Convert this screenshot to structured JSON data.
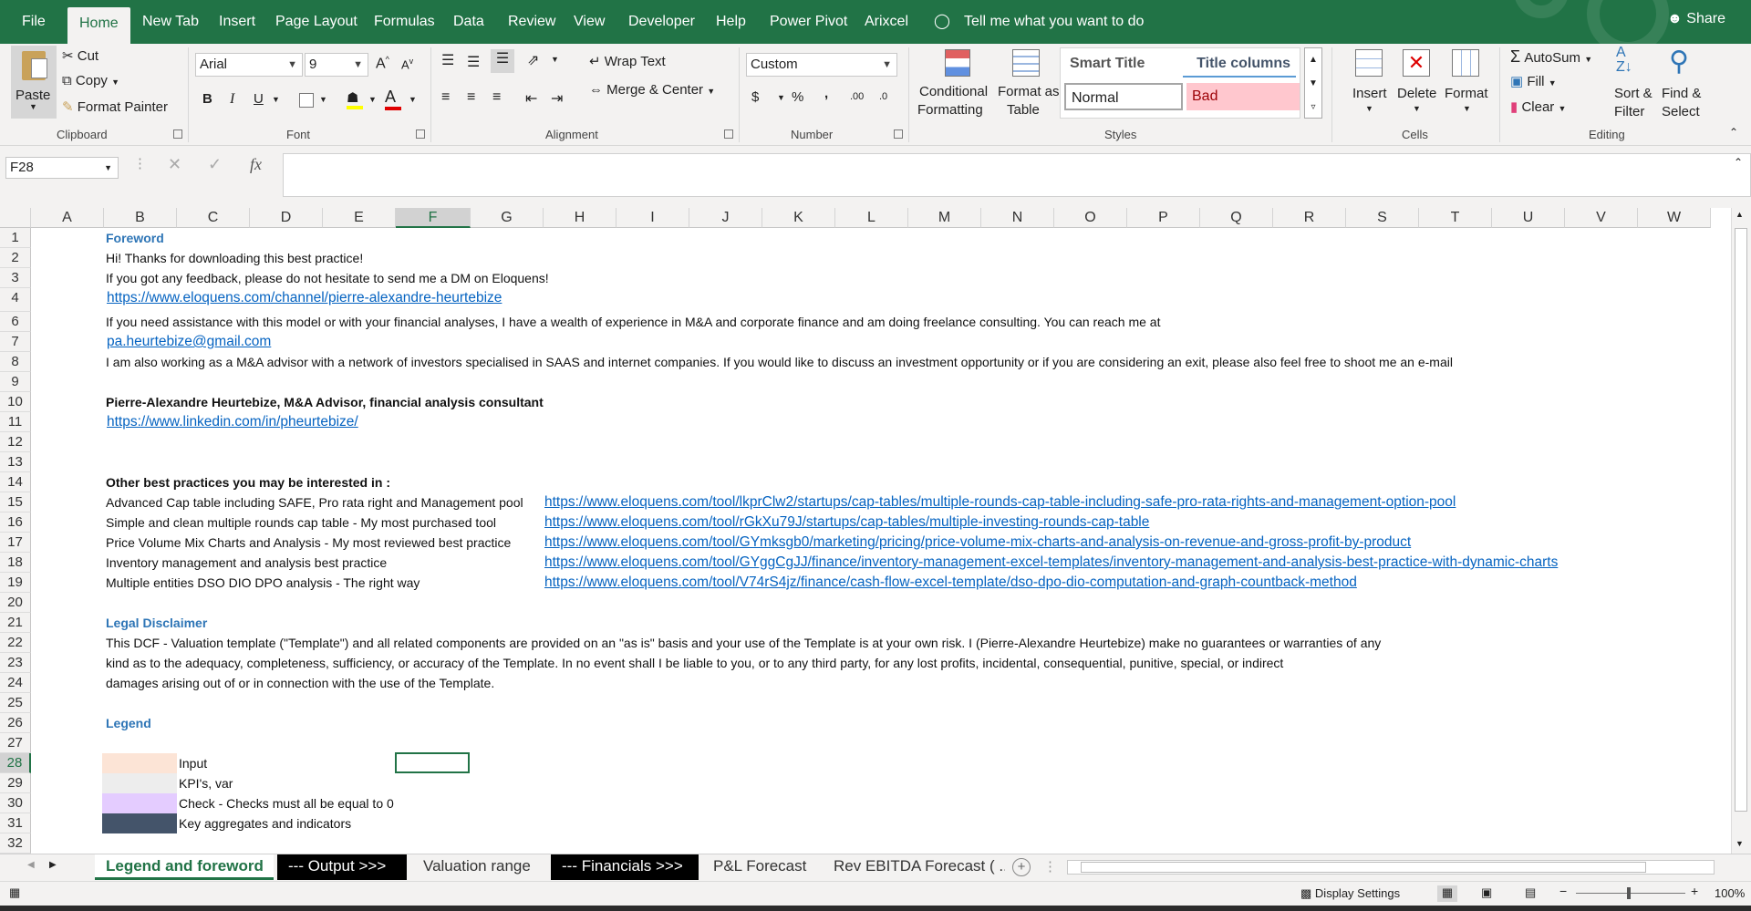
{
  "menu": {
    "tabs": [
      "File",
      "Home",
      "New Tab",
      "Insert",
      "Page Layout",
      "Formulas",
      "Data",
      "Review",
      "View",
      "Developer",
      "Help",
      "Power Pivot",
      "Arixcel"
    ],
    "tell_me": "Tell me what you want to do",
    "share": "Share"
  },
  "ribbon": {
    "clipboard": {
      "paste": "Paste",
      "cut": "Cut",
      "copy": "Copy",
      "format_painter": "Format Painter",
      "label": "Clipboard"
    },
    "font": {
      "name": "Arial",
      "size": "9",
      "bold": "B",
      "italic": "I",
      "underline": "U",
      "label": "Font"
    },
    "alignment": {
      "wrap": "Wrap Text",
      "merge": "Merge & Center",
      "label": "Alignment"
    },
    "number": {
      "format": "Custom",
      "percent": "%",
      "comma": ",",
      "inc_decimal": ".00",
      "dec_decimal": ".0",
      "label": "Number"
    },
    "styles": {
      "conditional_1": "Conditional",
      "conditional_2": "Formatting",
      "format_table_1": "Format as",
      "format_table_2": "Table",
      "smart_title": "Smart Title",
      "title_columns": "Title columns",
      "normal": "Normal",
      "bad": "Bad",
      "label": "Styles"
    },
    "cells": {
      "insert": "Insert",
      "delete": "Delete",
      "format": "Format",
      "label": "Cells"
    },
    "editing": {
      "autosum": "AutoSum",
      "fill": "Fill",
      "clear": "Clear",
      "sort_1": "Sort &",
      "sort_2": "Filter",
      "find_1": "Find &",
      "find_2": "Select",
      "label": "Editing"
    }
  },
  "formula_bar": {
    "name_box": "F28",
    "fx": "fx",
    "content": ""
  },
  "columns": [
    "A",
    "B",
    "C",
    "D",
    "E",
    "F",
    "G",
    "H",
    "I",
    "J",
    "K",
    "L",
    "M",
    "N",
    "O",
    "P",
    "Q",
    "R",
    "S",
    "T",
    "U",
    "V",
    "W"
  ],
  "selected_column": "F",
  "rows": [
    "1",
    "2",
    "3",
    "4",
    "6",
    "7",
    "8",
    "9",
    "10",
    "11",
    "12",
    "13",
    "14",
    "15",
    "16",
    "17",
    "18",
    "19",
    "20",
    "21",
    "22",
    "23",
    "24",
    "25",
    "26",
    "27",
    "28",
    "29",
    "30",
    "31",
    "32"
  ],
  "selected_row": "28",
  "content": {
    "foreword_title": "Foreword",
    "hi": "Hi! Thanks for downloading this best practice!",
    "feedback": "If you got any feedback, please do not hesitate to send me a DM on Eloquens!",
    "eloquens_link": "https://www.eloquens.com/channel/pierre-alexandre-heurtebize",
    "assistance": "If you need assistance with this model or with your financial analyses, I have a wealth of experience in M&A and corporate finance and am doing freelance consulting. You can reach me at",
    "email": "pa.heurtebize@gmail.com",
    "advisor_text": "I am also working as a M&A advisor with a network of investors specialised in SAAS and internet companies. If you would like to discuss an investment opportunity or if you are considering an exit, please also feel free to shoot me an e-mail",
    "signature": "Pierre-Alexandre Heurtebize, M&A Advisor, financial analysis consultant",
    "linkedin": "https://www.linkedin.com/in/pheurtebize/",
    "other_title": "Other best practices you may be interested in :",
    "practices": [
      {
        "name": "Advanced Cap table including SAFE, Pro rata right and Management pool",
        "url": "https://www.eloquens.com/tool/lkprClw2/startups/cap-tables/multiple-rounds-cap-table-including-safe-pro-rata-rights-and-management-option-pool"
      },
      {
        "name": "Simple and clean multiple rounds cap table - My most purchased tool",
        "url": "https://www.eloquens.com/tool/rGkXu79J/startups/cap-tables/multiple-investing-rounds-cap-table"
      },
      {
        "name": "Price Volume Mix Charts and Analysis - My most reviewed best practice",
        "url": "https://www.eloquens.com/tool/GYmksgb0/marketing/pricing/price-volume-mix-charts-and-analysis-on-revenue-and-gross-profit-by-product"
      },
      {
        "name": "Inventory management and analysis best practice",
        "url": "https://www.eloquens.com/tool/GYggCgJJ/finance/inventory-management-excel-templates/inventory-management-and-analysis-best-practice-with-dynamic-charts"
      },
      {
        "name": "Multiple entities DSO DIO DPO analysis - The right way",
        "url": "https://www.eloquens.com/tool/V74rS4jz/finance/cash-flow-excel-template/dso-dpo-dio-computation-and-graph-countback-method"
      }
    ],
    "legal_title": "Legal Disclaimer",
    "legal_1": "This DCF - Valuation template (\"Template\") and all related components are provided on an \"as is\" basis and your use of the Template is at your own risk.  I (Pierre-Alexandre Heurtebize) make no guarantees or warranties of any",
    "legal_2": "kind as to the adequacy, completeness, sufficiency, or accuracy of the Template. In no event shall I be liable to you, or to any third party, for any lost profits, incidental, consequential, punitive, special, or indirect",
    "legal_3": "damages arising out of or in connection with the use of the Template.",
    "legend_title": "Legend",
    "legend": [
      {
        "label": "Input",
        "color": "#fce4d6"
      },
      {
        "label": "KPI's, var",
        "color": "#ededed"
      },
      {
        "label": "Check - Checks must all be equal to 0",
        "color": "#e4ccff"
      },
      {
        "label": "Key aggregates and indicators",
        "color": "#44546a"
      }
    ]
  },
  "sheet_tabs": [
    "Legend and foreword",
    "--- Output >>>",
    "Valuation range",
    "--- Financials >>>",
    "P&L Forecast",
    "Rev EBITDA Forecast ( ..."
  ],
  "status": {
    "display_settings": "Display Settings",
    "zoom": "100%"
  },
  "colors": {
    "excel_green": "#217346",
    "link_blue": "#0563c1",
    "title_blue": "#2e75b6"
  }
}
